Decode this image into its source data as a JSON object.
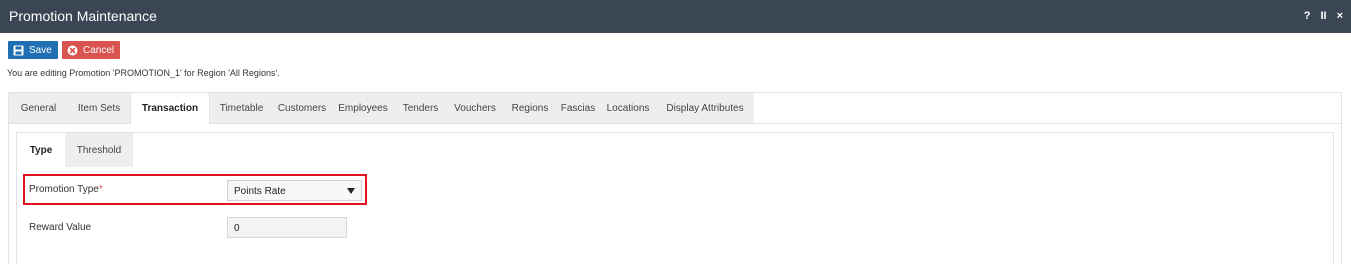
{
  "window": {
    "title": "Promotion Maintenance",
    "controls": [
      "?",
      "II",
      "×"
    ]
  },
  "toolbar": {
    "save_label": "Save",
    "cancel_label": "Cancel"
  },
  "editing_message": "You are editing Promotion 'PROMOTION_1' for Region 'All Regions'.",
  "main_tabs": [
    {
      "label": "General"
    },
    {
      "label": "Item Sets"
    },
    {
      "label": "Transaction",
      "active": true
    },
    {
      "label": "Timetable"
    },
    {
      "label": "Customers"
    },
    {
      "label": "Employees"
    },
    {
      "label": "Tenders"
    },
    {
      "label": "Vouchers"
    },
    {
      "label": "Regions"
    },
    {
      "label": "Fascias"
    },
    {
      "label": "Locations"
    },
    {
      "label": "Display Attributes"
    }
  ],
  "sub_tabs": [
    {
      "label": "Type",
      "active": true
    },
    {
      "label": "Threshold"
    }
  ],
  "form": {
    "promotion_type_label": "Promotion Type",
    "promotion_type_required_mark": "*",
    "promotion_type_value": "Points Rate",
    "reward_value_label": "Reward Value",
    "reward_value": "0"
  },
  "colors": {
    "titlebar": "#3b4654",
    "save": "#1f6fb2",
    "cancel": "#d9534f",
    "highlight": "#e0141e"
  }
}
